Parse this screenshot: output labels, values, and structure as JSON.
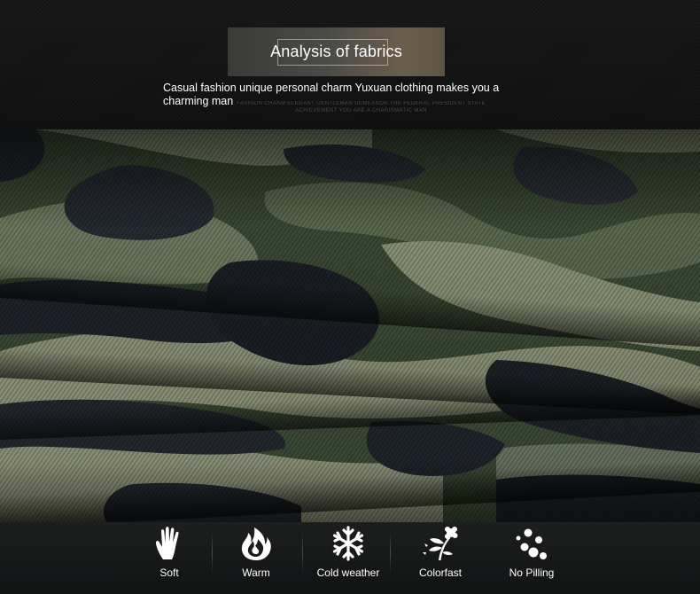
{
  "header": {
    "title": "Analysis of fabrics",
    "tagline": "Casual fashion unique personal charm Yuxuan clothing makes you a charming man",
    "small_print": "FASHION CHARM ELEGANT GENTLEMAN DEMEANOR THE FEDERAL PRESIDENT STATE ACHIEVEMENT YOU ARE A CHARISMATIC MAN"
  },
  "features": [
    {
      "label": "Soft",
      "icon": "hand-icon"
    },
    {
      "label": "Warm",
      "icon": "flame-icon"
    },
    {
      "label": "Cold weather",
      "icon": "snowflake-icon"
    },
    {
      "label": "Colorfast",
      "icon": "flower-icon"
    },
    {
      "label": "No Pilling",
      "icon": "dots-icon"
    }
  ],
  "colors": {
    "camo_dark": "#1f242a",
    "camo_mid": "#3b4a35",
    "camo_light": "#8c9478",
    "camo_sage": "#5d6b52"
  }
}
